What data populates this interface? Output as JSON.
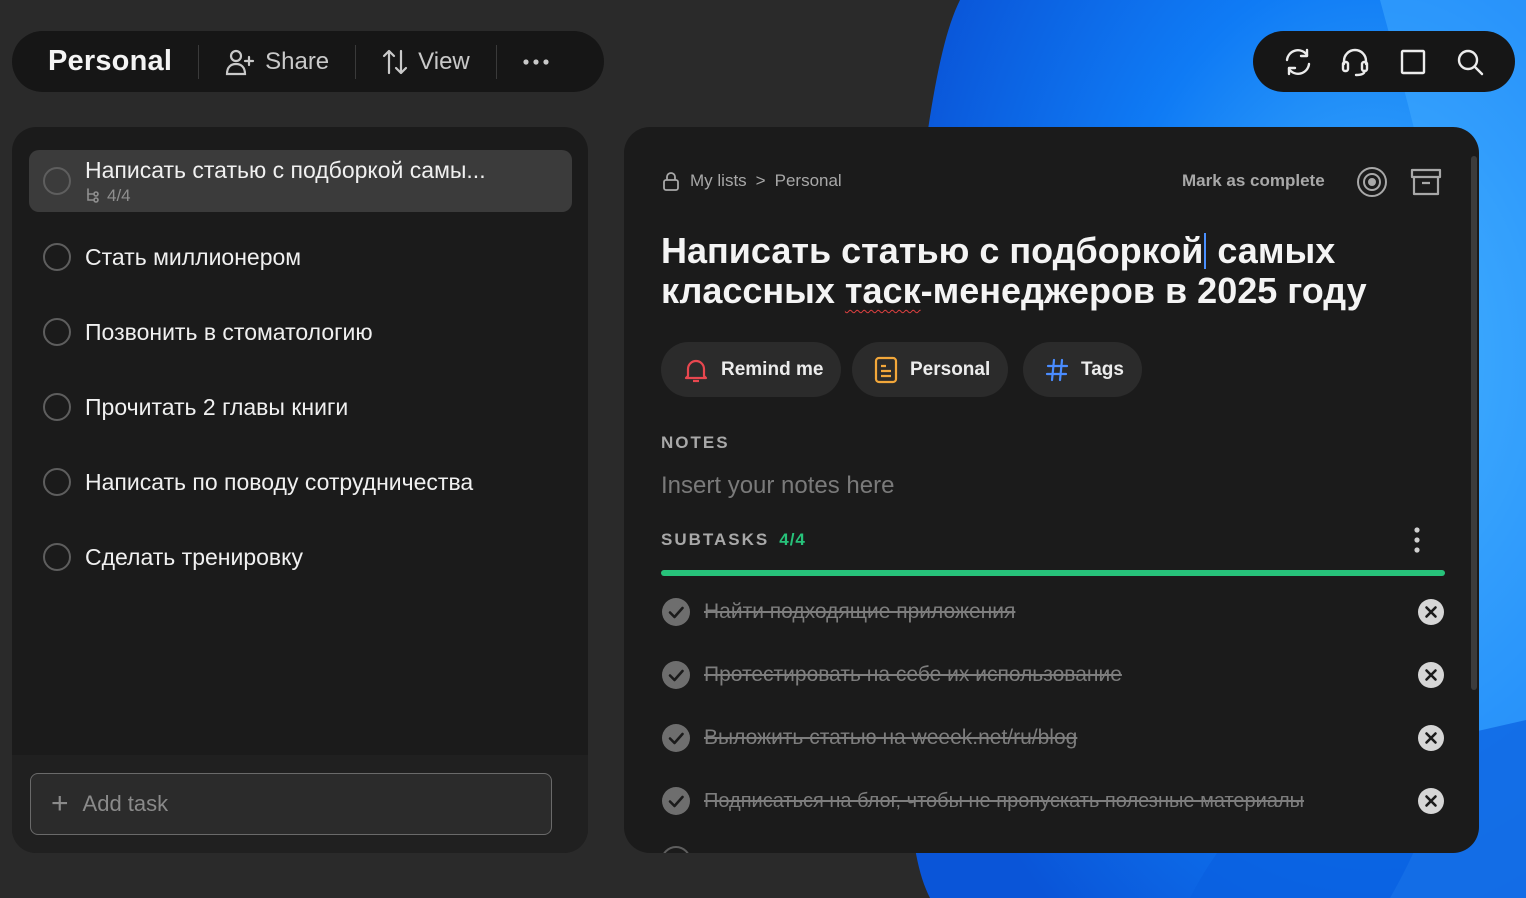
{
  "toolbar": {
    "list_title": "Personal",
    "share_label": "Share",
    "view_label": "View",
    "more_icon": "more-horizontal-icon"
  },
  "right_toolbar": {
    "icons": [
      "sync-icon",
      "headset-icon",
      "window-icon",
      "search-icon"
    ]
  },
  "tasks": [
    {
      "title": "Написать статью с подборкой самы...",
      "subtasks": "4/4",
      "active": true
    },
    {
      "title": "Стать миллионером"
    },
    {
      "title": "Позвонить в стоматологию"
    },
    {
      "title": "Прочитать 2 главы книги"
    },
    {
      "title": "Написать по поводу сотрудничества"
    },
    {
      "title": "Сделать тренировку"
    }
  ],
  "add_task": {
    "placeholder": "Add task"
  },
  "detail": {
    "breadcrumb": {
      "root": "My lists",
      "separator": ">",
      "current": "Personal"
    },
    "mark_complete": "Mark as complete",
    "title_part1": "Написать статью с подборкой",
    "title_part2": " самых",
    "title_part3": "классных ",
    "title_misspelled": "таск",
    "title_part4": "-менеджеров в 2025 году",
    "chips": {
      "remind": "Remind me",
      "list": "Personal",
      "tags": "Tags"
    },
    "notes_label": "NOTES",
    "notes_placeholder": "Insert your notes here",
    "subtasks_label": "SUBTASKS",
    "subtasks_count": "4/4",
    "subtasks_progress": 1.0,
    "subtasks": [
      "Найти подходящие приложения",
      "Протестировать на себе их использование",
      "Выложить статью на weeek.net/ru/blog",
      "Подписаться на блог, чтобы не пропускать полезные материалы"
    ]
  },
  "colors": {
    "accent_green": "#27c27a",
    "bell_red": "#e8474f",
    "list_yellow": "#f2a73a",
    "tags_blue": "#4a8cff",
    "wallpaper_blue": "#1a84ff"
  }
}
